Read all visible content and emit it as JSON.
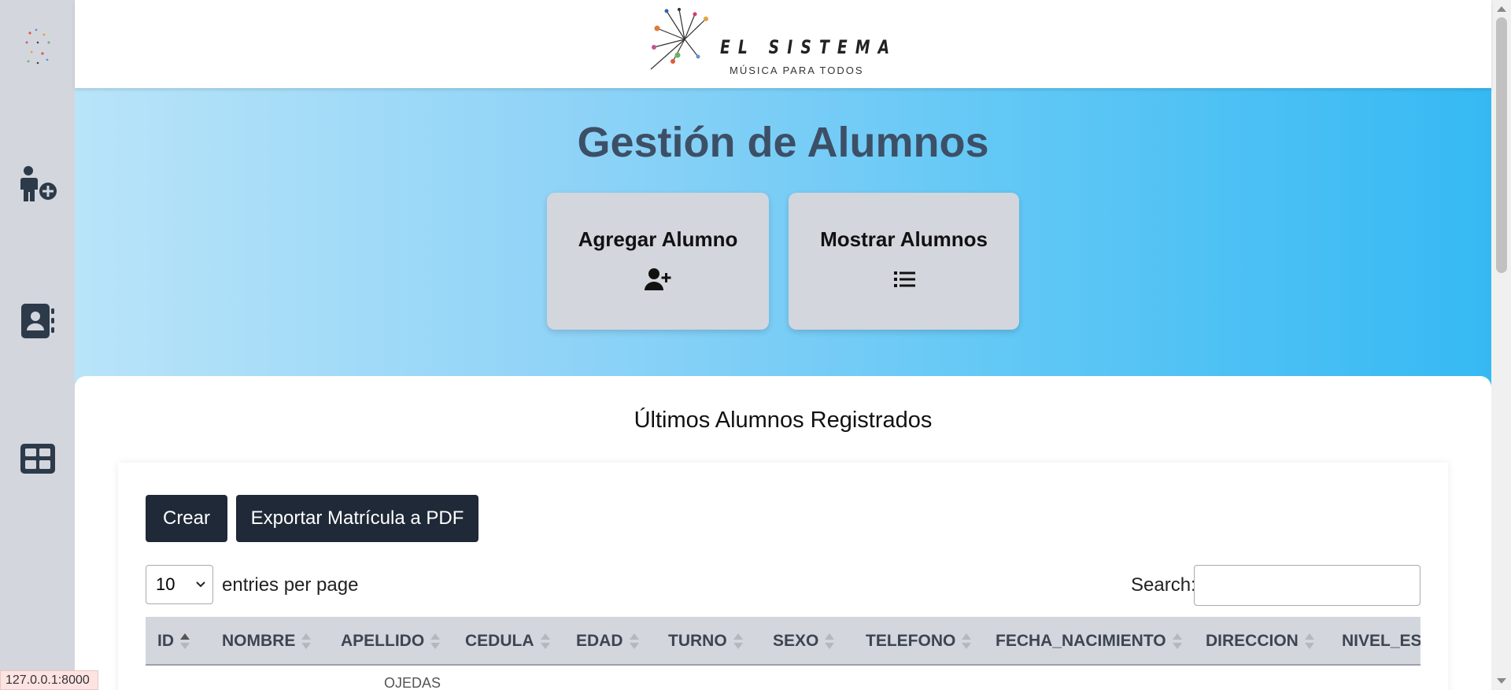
{
  "brand": {
    "name": "EL SISTEMA",
    "tagline": "MÚSICA PARA TODOS"
  },
  "sidebar": {
    "items": [
      {
        "icon": "add-student-icon"
      },
      {
        "icon": "contact-book-icon"
      },
      {
        "icon": "dashboard-grid-icon"
      }
    ]
  },
  "hero": {
    "title": "Gestión de Alumnos",
    "cards": [
      {
        "label": "Agregar Alumno",
        "icon": "user-plus-icon"
      },
      {
        "label": "Mostrar Alumnos",
        "icon": "list-icon"
      }
    ]
  },
  "panel": {
    "title": "Últimos Alumnos Registrados"
  },
  "toolbar": {
    "create_label": "Crear",
    "export_label": "Exportar Matrícula a PDF"
  },
  "table": {
    "entries_value": "10",
    "entries_label": "entries per page",
    "search_label": "Search:",
    "search_value": "",
    "columns": [
      "ID",
      "NOMBRE",
      "APELLIDO",
      "CEDULA",
      "EDAD",
      "TURNO",
      "SEXO",
      "TELEFONO",
      "FECHA_NACIMIENTO",
      "DIRECCION",
      "NIVEL_EST"
    ],
    "sorted_column": "ID",
    "first_row_partial": "OJEDAS"
  },
  "status_bar": {
    "url": "127.0.0.1:8000"
  },
  "colors": {
    "sidebar_bg": "#d3d6dd",
    "hero_gradient_start": "#b9e4f9",
    "hero_gradient_end": "#36b9f3",
    "title_color": "#3d4f66",
    "button_bg": "#1f2937"
  }
}
